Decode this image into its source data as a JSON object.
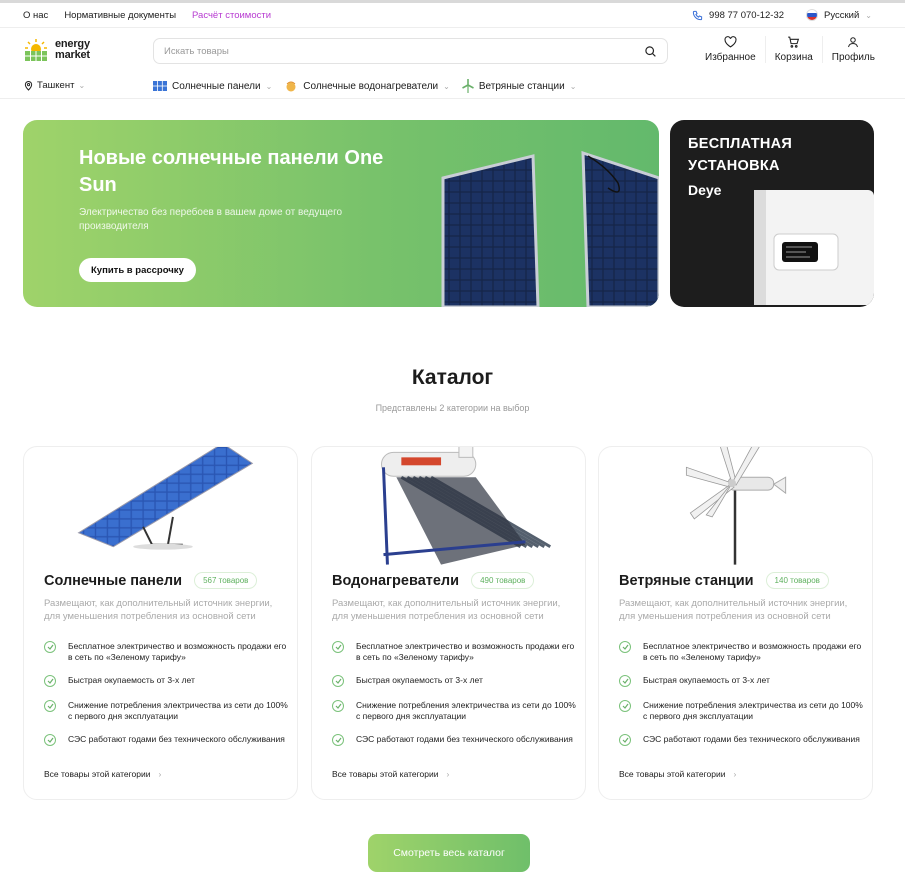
{
  "topbar": {
    "links": [
      "О нас",
      "Нормативные документы",
      "Расчёт стоимости"
    ],
    "active_link_color": "#b73bd1",
    "phone": "998 77 070-12-32",
    "language": "Русский"
  },
  "header": {
    "logo_line1": "energy",
    "logo_line2": "market",
    "search_placeholder": "Искать товары",
    "favorites_label": "Избранное",
    "cart_label": "Корзина",
    "profile_label": "Профиль"
  },
  "catnav": {
    "city": "Ташкент",
    "items": [
      "Солнечные панели",
      "Солнечные водонагреватели",
      "Ветряные станции"
    ]
  },
  "hero": {
    "title": "Новые солнечные панели One Sun",
    "subtitle": "Электричество без перебоев в вашем доме от ведущего производителя",
    "button": "Купить в рассрочку"
  },
  "promo": {
    "title": "БЕСПЛАТНАЯ УСТАНОВКА",
    "brand": "Deye"
  },
  "catalog": {
    "title": "Каталог",
    "subtitle": "Представлены 2 категории на выбор",
    "cards": [
      {
        "title": "Солнечные панели",
        "count": "567 товаров",
        "desc": "Размещают, как дополнительный источник энергии, для уменьшения потребления из основной сети",
        "features": [
          "Бесплатное электричество и возможность продажи его в сеть по «Зеленому тарифу»",
          "Быстрая окупаемость от 3-х лет",
          "Снижение потребления электричества из сети до 100% с первого дня эксплуатации",
          "СЭС работают годами без технического обслуживания"
        ],
        "all_link": "Все товары этой категории"
      },
      {
        "title": "Водонагреватели",
        "count": "490 товаров",
        "desc": "Размещают, как дополнительный источник энергии, для уменьшения потребления из основной сети",
        "features": [
          "Бесплатное электричество и возможность продажи его в сеть по «Зеленому тарифу»",
          "Быстрая окупаемость от 3-х лет",
          "Снижение потребления электричества из сети до 100% с первого дня эксплуатации",
          "СЭС работают годами без технического обслуживания"
        ],
        "all_link": "Все товары этой категории"
      },
      {
        "title": "Ветряные станции",
        "count": "140 товаров",
        "desc": "Размещают, как дополнительный источник энергии, для уменьшения потребления из основной сети",
        "features": [
          "Бесплатное электричество и возможность продажи его в сеть по «Зеленому тарифу»",
          "Быстрая окупаемость от 3-х лет",
          "Снижение потребления электричества из сети до 100% с первого дня эксплуатации",
          "СЭС работают годами без технического обслуживания"
        ],
        "all_link": "Все товары этой категории"
      }
    ],
    "cta": "Смотреть весь каталог"
  },
  "colors": {
    "accent": "#78c26b",
    "accent_light": "#9fd36a",
    "promo_bg": "#1d1d1d"
  },
  "icons": [
    "phone-icon",
    "flag-icon",
    "logo-sun-icon",
    "search-icon",
    "heart-icon",
    "cart-icon",
    "user-icon",
    "location-icon",
    "solar-panel-icon",
    "water-heater-icon",
    "wind-icon",
    "check-icon",
    "chevron-right-icon"
  ]
}
